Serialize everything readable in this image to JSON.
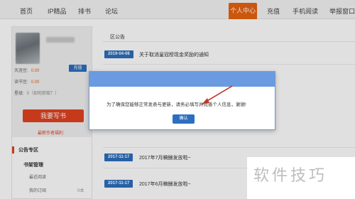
{
  "nav": {
    "items": [
      "首页",
      "IP精品",
      "排书",
      "论坛",
      "个人中心",
      "充值",
      "手机阅读",
      "举报窗口"
    ]
  },
  "sidebar": {
    "stats": [
      {
        "label": "天涯豆:",
        "value": "0.00"
      },
      {
        "label": "读书豆:",
        "value": "0.00"
      },
      {
        "label": "星级:",
        "value": "0（如何获取？）"
      }
    ],
    "recharge_label": "充值",
    "write_label": "我要写书",
    "writer_benefit": "最新作者福利",
    "menu": [
      {
        "label": "公告专区",
        "type": "section"
      },
      {
        "label": "书架管理",
        "type": "group"
      },
      {
        "label": "最近阅读",
        "type": "sub"
      },
      {
        "label": "我的订阅",
        "type": "sub",
        "count": "0本"
      }
    ]
  },
  "main": {
    "title": "区公告",
    "notices": [
      {
        "date": "2019-04-08",
        "text": "关于取消皇冠榜现金奖励的通知"
      },
      {
        "date": "2017-11-17",
        "text": "2017年7月稿酬发放啦~"
      },
      {
        "date": "2017-11-17",
        "text": "2017年6月稿酬发放啦~"
      }
    ]
  },
  "dialog": {
    "message": "为了确保您能够正常发表与更新，请务必填写并完善个人信息，谢谢!",
    "confirm_label": "确认"
  },
  "watermark": "软件技巧",
  "colors": {
    "accent_orange": "#e8620f",
    "brand_blue": "#2c6fbf",
    "write_red": "#e0431f"
  }
}
